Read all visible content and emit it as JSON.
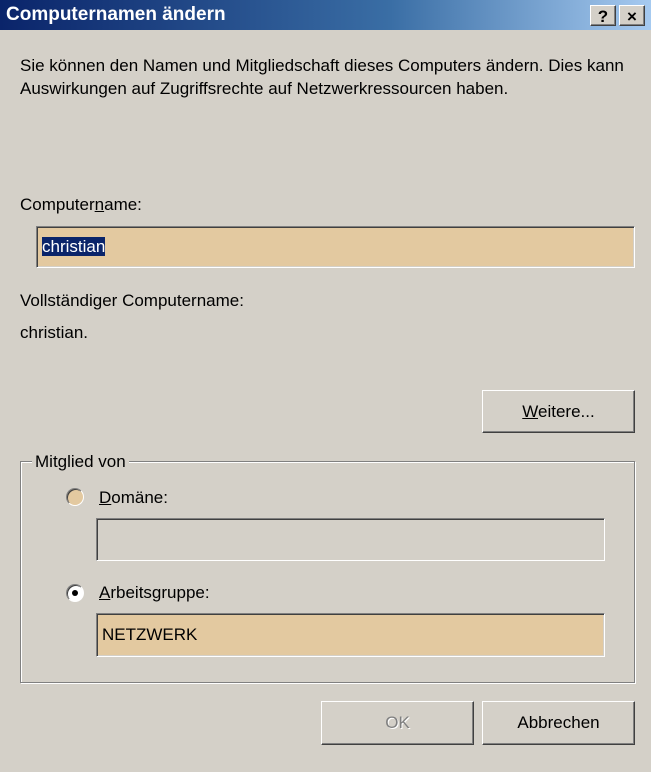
{
  "window": {
    "title": "Computernamen ändern",
    "help_label": "?",
    "close_label": "×"
  },
  "description": "Sie können den Namen und Mitgliedschaft dieses Computers ändern. Dies kann Auswirkungen auf Zugriffsrechte auf Netzwerkressourcen haben.",
  "computer_name": {
    "label_pre": "Computer",
    "label_accel": "n",
    "label_post": "ame:",
    "value": "christian"
  },
  "full_name": {
    "label": "Vollständiger Computername:",
    "value": "christian."
  },
  "more_button": {
    "accel": "W",
    "rest": "eitere..."
  },
  "member_of": {
    "label": "Mitglied von",
    "domain": {
      "accel": "D",
      "rest": "omäne:",
      "value": "",
      "selected": false
    },
    "workgroup": {
      "accel": "A",
      "rest": "rbeitsgruppe:",
      "value": "NETZWERK",
      "selected": true
    }
  },
  "buttons": {
    "ok": "OK",
    "cancel": "Abbrechen"
  },
  "colors": {
    "titlebar_start": "#0a246a",
    "face": "#d4d0c8",
    "field_highlight": "#e3c9a0"
  }
}
